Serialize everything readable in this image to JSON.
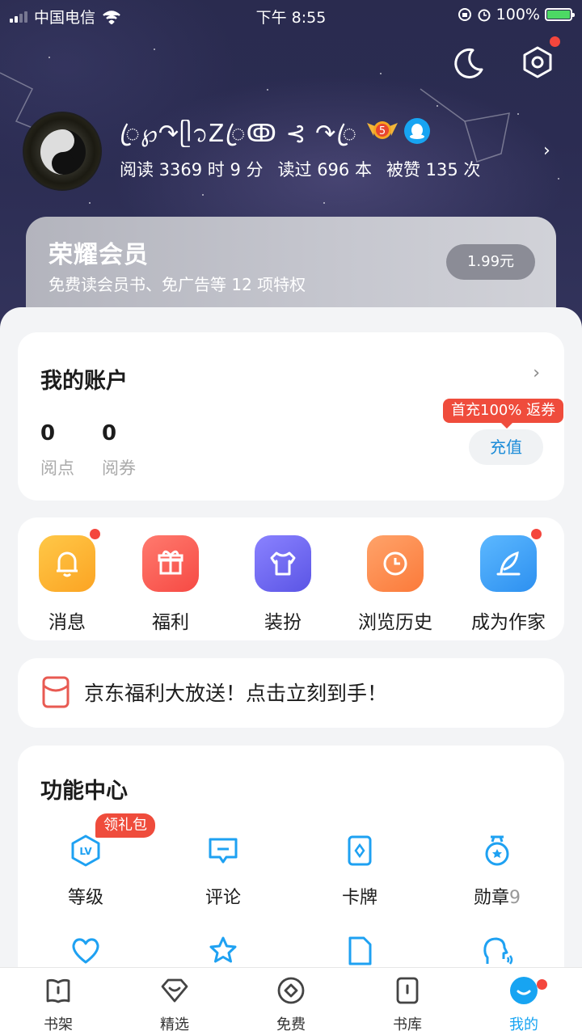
{
  "status_bar": {
    "carrier": "中国电信",
    "time": "下午 8:55",
    "battery": "100%"
  },
  "profile": {
    "nickname": "ꦿ℘↷ᥫ᭡Ꮓꦿↂ ⊰ ↷ꦿ",
    "level": "5",
    "stats": [
      "阅读 3369 时 9 分",
      "读过 696 本",
      "被赞 135 次"
    ]
  },
  "vip": {
    "title": "荣耀会员",
    "subtitle": "免费读会员书、免广告等 12 项特权",
    "price": "1.99元"
  },
  "account": {
    "title": "我的账户",
    "read_points": {
      "value": "0",
      "label": "阅点"
    },
    "vouchers": {
      "value": "0",
      "label": "阅券"
    },
    "promo": "首充100% 返券",
    "recharge": "充值"
  },
  "quick_actions": [
    {
      "label": "消息",
      "color": "#fdb731",
      "dot": true
    },
    {
      "label": "福利",
      "color": "#f95f58",
      "dot": false
    },
    {
      "label": "装扮",
      "color": "#6f69ef",
      "dot": false
    },
    {
      "label": "浏览历史",
      "color": "#fd8a4c",
      "dot": false
    },
    {
      "label": "成为作家",
      "color": "#3ba3f6",
      "dot": true
    }
  ],
  "banner": {
    "text": "京东福利大放送！点击立刻到手！"
  },
  "function_center": {
    "title": "功能中心",
    "gift_tag": "领礼包",
    "items": [
      {
        "label": "等级",
        "icon": "level-icon"
      },
      {
        "label": "评论",
        "icon": "comment-icon"
      },
      {
        "label": "卡牌",
        "icon": "card-icon"
      },
      {
        "label": "勋章",
        "icon": "medal-icon",
        "count": "9"
      },
      {
        "label": "",
        "icon": "heart-icon"
      },
      {
        "label": "",
        "icon": "star-icon"
      },
      {
        "label": "",
        "icon": "document-icon"
      },
      {
        "label": "",
        "icon": "voice-icon"
      }
    ]
  },
  "tabbar": [
    {
      "label": "书架",
      "icon": "bookshelf-icon"
    },
    {
      "label": "精选",
      "icon": "featured-icon"
    },
    {
      "label": "免费",
      "icon": "free-icon"
    },
    {
      "label": "书库",
      "icon": "library-icon"
    },
    {
      "label": "我的",
      "icon": "me-icon",
      "active": true
    }
  ],
  "colors": {
    "accent": "#17a4f2",
    "promo": "#ef4c3c",
    "hero": "#2b2c52"
  }
}
